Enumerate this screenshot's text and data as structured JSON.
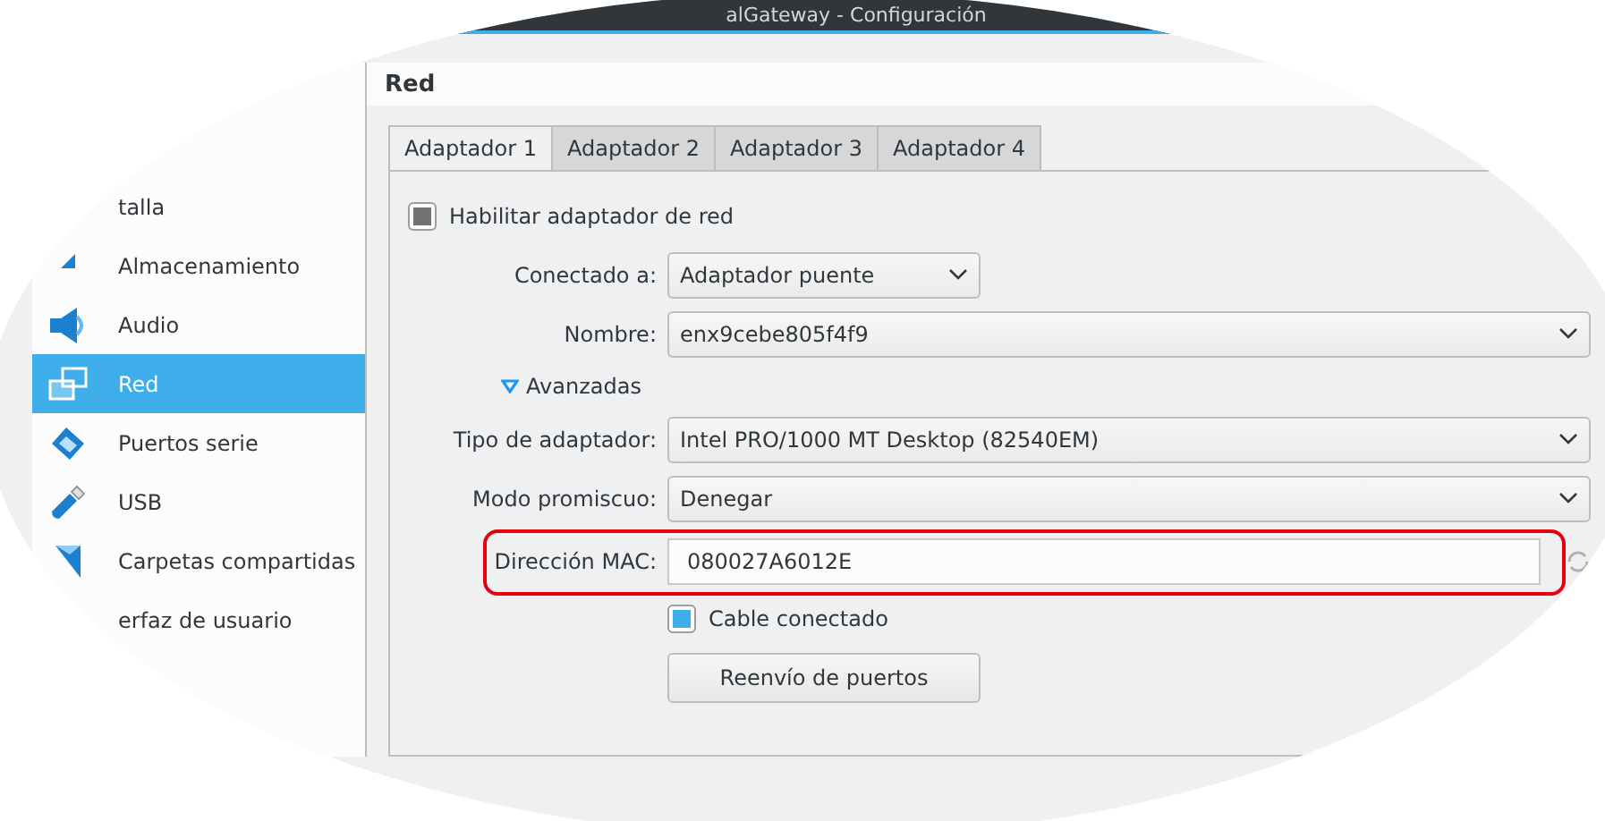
{
  "window": {
    "title": "alGateway - Configuración"
  },
  "sidebar": {
    "items": [
      {
        "label": "talla",
        "kind": "none",
        "selected": false
      },
      {
        "label": "Almacenamiento",
        "kind": "storage",
        "selected": false
      },
      {
        "label": "Audio",
        "kind": "audio",
        "selected": false
      },
      {
        "label": "Red",
        "kind": "network",
        "selected": true
      },
      {
        "label": "Puertos serie",
        "kind": "serial",
        "selected": false
      },
      {
        "label": "USB",
        "kind": "usb",
        "selected": false
      },
      {
        "label": "Carpetas compartidas",
        "kind": "folder",
        "selected": false
      },
      {
        "label": "erfaz de usuario",
        "kind": "none",
        "selected": false
      }
    ]
  },
  "page_title": "Red",
  "tabs": [
    {
      "label": "Adaptador 1",
      "selected": true
    },
    {
      "label": "Adaptador 2",
      "selected": false
    },
    {
      "label": "Adaptador 3",
      "selected": false
    },
    {
      "label": "Adaptador 4",
      "selected": false
    }
  ],
  "enable_adapter": {
    "label": "Habilitar adaptador de red",
    "checked": true,
    "disabled": true
  },
  "fields": [
    {
      "kind": "combo",
      "label": "Conectado a:",
      "value": "Adaptador puente",
      "short": true
    },
    {
      "kind": "combo",
      "label": "Nombre:",
      "value": "enx9cebe805f4f9",
      "short": false
    },
    {
      "kind": "toggle",
      "label": "Avanzadas",
      "expanded": true
    },
    {
      "kind": "combo",
      "label": "Tipo de adaptador:",
      "value": "Intel PRO/1000 MT Desktop (82540EM)",
      "short": false
    },
    {
      "kind": "combo",
      "label": "Modo promiscuo:",
      "value": "Denegar",
      "short": false
    },
    {
      "kind": "mac",
      "label": "Dirección MAC:",
      "value": "080027A6012E",
      "highlighted": true
    },
    {
      "kind": "checkbox",
      "label": "Cable conectado",
      "checked": true,
      "disabled": false
    },
    {
      "kind": "button",
      "label": "Reenvío de puertos"
    }
  ]
}
